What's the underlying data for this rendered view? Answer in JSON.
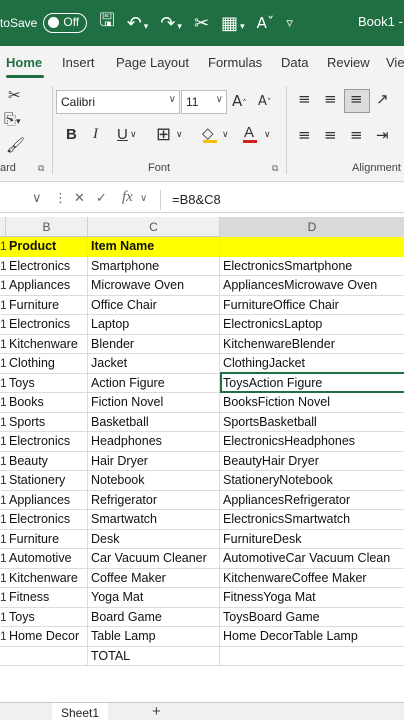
{
  "titlebar": {
    "autosave_label": "toSave",
    "autosave_state": "Off",
    "title": "Book1 -",
    "icons": [
      "save-icon",
      "undo-icon",
      "redo-icon",
      "cut-icon",
      "format-icon",
      "font-size-icon",
      "customize-icon"
    ]
  },
  "tabs": [
    "Home",
    "Insert",
    "Page Layout",
    "Formulas",
    "Data",
    "Review",
    "Vie"
  ],
  "ribbon": {
    "font_name": "Calibri",
    "font_size": "11",
    "labels": {
      "clipboard": "ard",
      "font": "Font",
      "alignment": "Alignment"
    },
    "buttons": {
      "bold": "B",
      "italic": "I",
      "underline": "U",
      "grow": "A",
      "shrink": "A",
      "font_color": "A"
    }
  },
  "formula_bar": {
    "formula": "=B8&C8"
  },
  "columns": [
    "B",
    "C",
    "D"
  ],
  "header_row": {
    "b": "Product",
    "c": "Item Name",
    "d": ""
  },
  "rows": [
    {
      "a": "1",
      "b": "Electronics",
      "c": "Smartphone",
      "d": "ElectronicsSmartphone"
    },
    {
      "a": "1",
      "b": "Appliances",
      "c": "Microwave Oven",
      "d": "AppliancesMicrowave Oven"
    },
    {
      "a": "1",
      "b": "Furniture",
      "c": "Office Chair",
      "d": "FurnitureOffice Chair"
    },
    {
      "a": "1",
      "b": "Electronics",
      "c": "Laptop",
      "d": "ElectronicsLaptop"
    },
    {
      "a": "1",
      "b": "Kitchenware",
      "c": "Blender",
      "d": "KitchenwareBlender"
    },
    {
      "a": "1",
      "b": "Clothing",
      "c": "Jacket",
      "d": "ClothingJacket"
    },
    {
      "a": "1",
      "b": "Toys",
      "c": "Action Figure",
      "d": "ToysAction Figure"
    },
    {
      "a": "1",
      "b": "Books",
      "c": "Fiction Novel",
      "d": "BooksFiction Novel"
    },
    {
      "a": "1",
      "b": "Sports",
      "c": "Basketball",
      "d": "SportsBasketball"
    },
    {
      "a": "1",
      "b": "Electronics",
      "c": "Headphones",
      "d": "ElectronicsHeadphones"
    },
    {
      "a": "1",
      "b": "Beauty",
      "c": "Hair Dryer",
      "d": "BeautyHair Dryer"
    },
    {
      "a": "1",
      "b": "Stationery",
      "c": "Notebook",
      "d": "StationeryNotebook"
    },
    {
      "a": "1",
      "b": "Appliances",
      "c": "Refrigerator",
      "d": "AppliancesRefrigerator"
    },
    {
      "a": "1",
      "b": "Electronics",
      "c": "Smartwatch",
      "d": "ElectronicsSmartwatch"
    },
    {
      "a": "1",
      "b": "Furniture",
      "c": "Desk",
      "d": "FurnitureDesk"
    },
    {
      "a": "1",
      "b": "Automotive",
      "c": "Car Vacuum Cleaner",
      "d": "AutomotiveCar Vacuum Clean"
    },
    {
      "a": "1",
      "b": "Kitchenware",
      "c": "Coffee Maker",
      "d": "KitchenwareCoffee Maker"
    },
    {
      "a": "1",
      "b": "Fitness",
      "c": "Yoga Mat",
      "d": "FitnessYoga Mat"
    },
    {
      "a": "1",
      "b": "Toys",
      "c": "Board Game",
      "d": "ToysBoard Game"
    },
    {
      "a": "1",
      "b": "Home Decor",
      "c": "Table Lamp",
      "d": "Home DecorTable Lamp"
    },
    {
      "a": "",
      "b": "",
      "c": "TOTAL",
      "d": ""
    }
  ],
  "sheets": [
    "Sheet1"
  ],
  "add_sheet": "+"
}
